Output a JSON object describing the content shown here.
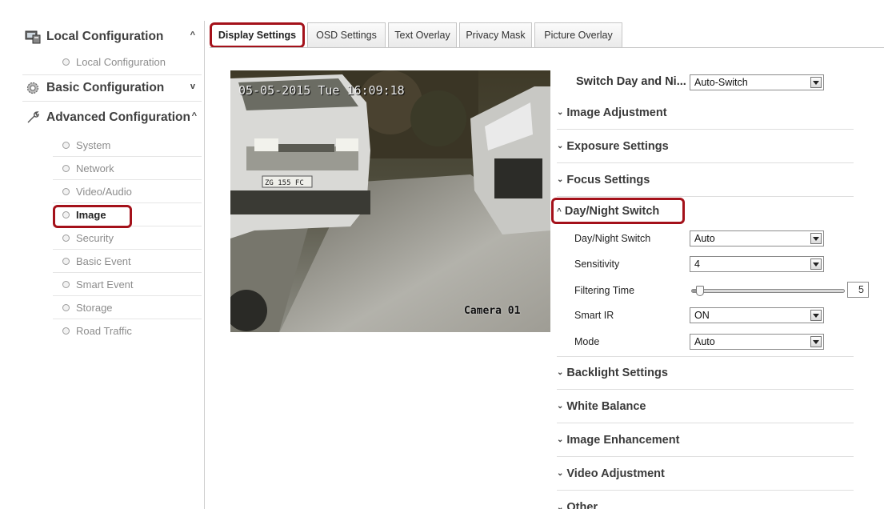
{
  "sidebar": {
    "sections": [
      {
        "label": "Local Configuration",
        "icon": "local-config-icon",
        "chevron": "^"
      },
      {
        "label": "Basic Configuration",
        "icon": "gear-icon",
        "chevron": "v"
      },
      {
        "label": "Advanced Configuration",
        "icon": "wrench-icon",
        "chevron": "^"
      }
    ],
    "local_items": [
      "Local Configuration"
    ],
    "advanced_items": [
      "System",
      "Network",
      "Video/Audio",
      "Image",
      "Security",
      "Basic Event",
      "Smart Event",
      "Storage",
      "Road Traffic"
    ],
    "active_item": "Image"
  },
  "tabs": [
    "Display Settings",
    "OSD Settings",
    "Text Overlay",
    "Privacy Mask",
    "Picture Overlay"
  ],
  "active_tab": "Display Settings",
  "video": {
    "timestamp": "05-05-2015 Tue 16:09:18",
    "camera_name": "Camera 01",
    "plate": "ZG 155 FC"
  },
  "settings": {
    "switch_day_night_label": "Switch Day and Ni...",
    "switch_day_night_value": "Auto-Switch",
    "sections_top": [
      "Image Adjustment",
      "Exposure Settings",
      "Focus Settings"
    ],
    "daynight_section": "Day/Night Switch",
    "daynight_rows": {
      "daynight_label": "Day/Night Switch",
      "daynight_value": "Auto",
      "sensitivity_label": "Sensitivity",
      "sensitivity_value": "4",
      "filtering_label": "Filtering Time",
      "filtering_value": "5",
      "filtering_level": 0.05,
      "smartir_label": "Smart IR",
      "smartir_value": "ON",
      "mode_label": "Mode",
      "mode_value": "Auto"
    },
    "sections_bottom": [
      "Backlight Settings",
      "White Balance",
      "Image Enhancement",
      "Video Adjustment",
      "Other"
    ]
  },
  "colors": {
    "highlight": "#a4111a"
  }
}
